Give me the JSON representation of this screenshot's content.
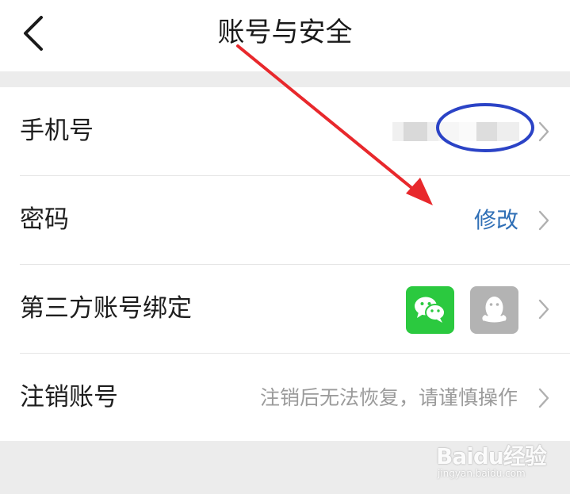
{
  "header": {
    "title": "账号与安全"
  },
  "rows": [
    {
      "label": "手机号",
      "value": ""
    },
    {
      "label": "密码",
      "value": "修改"
    },
    {
      "label": "第三方账号绑定",
      "value": ""
    },
    {
      "label": "注销账号",
      "value": "注销后无法恢复，请谨慎操作"
    }
  ],
  "third_party_icons": [
    "wechat-icon",
    "qq-icon"
  ],
  "colors": {
    "modify_link": "#2f6fb6",
    "annotation_ellipse": "#2b43c6",
    "annotation_arrow": "#e8282c",
    "wechat": "#2bc93f",
    "qq": "#b3b3b3"
  },
  "watermark": {
    "brand": "Baidu经验",
    "url": "jingyan.baidu.com"
  }
}
